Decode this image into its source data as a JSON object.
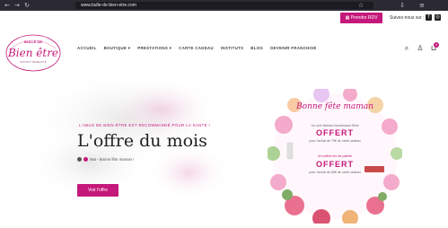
{
  "browser": {
    "url": "www.bulle-de-bien-etre.com",
    "back_icon": "arrow-left-icon",
    "forward_icon": "arrow-right-icon",
    "reload_icon": "reload-icon"
  },
  "topbar": {
    "rdv_label": "Prendre RDV",
    "follow_label": "Suivez-nous sur :",
    "social": [
      "facebook-icon",
      "instagram-icon"
    ]
  },
  "logo": {
    "top": "BULLE DE",
    "main": "Bien être",
    "bottom": "INSTITUT DE BEAUTÉ"
  },
  "nav": {
    "items": [
      {
        "label": "ACCUEIL"
      },
      {
        "label": "BOUTIQUE ▾"
      },
      {
        "label": "PRESTATIONS ▾"
      },
      {
        "label": "CARTE CADEAU"
      },
      {
        "label": "INSTITUTS"
      },
      {
        "label": "BLOG"
      },
      {
        "label": "DEVENIR FRANCHISÉ"
      }
    ],
    "cart_count": "0"
  },
  "hero": {
    "tagline": "L'ABUS DE BIEN-ÊTRE EST RECOMMANDÉ POUR LA SANTÉ !",
    "title": "L'offre du mois",
    "author": "Mai - Bonne fête maman !",
    "cta": "Voir l'offre"
  },
  "promo": {
    "heading": "Bonne fête maman",
    "offer1_line": "Un soin Nutrisu-Nourrissant 50ml",
    "offer1_big": "OFFERT",
    "offer1_sub": "pour l'achat de 70€ de carte cadeau",
    "offer2_line": "Un coffret trio de palette",
    "offer2_big": "OFFERT",
    "offer2_sub": "pour l'achat de 80€ de carte cadeau"
  },
  "colors": {
    "accent": "#c4187a",
    "chrome": "#2b2a33"
  }
}
